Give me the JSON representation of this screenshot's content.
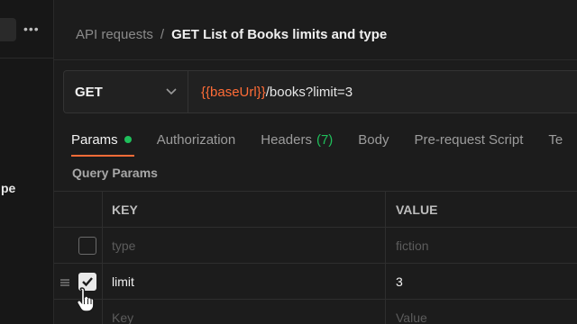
{
  "sidebar": {
    "more_icon": "more-horizontal-icon",
    "cut_item_text": "pe"
  },
  "breadcrumb": {
    "parent": "API requests",
    "separator": "/",
    "current": "GET List of Books limits and type"
  },
  "request": {
    "method": "GET",
    "url_variable": "{{baseUrl}}",
    "url_path": "/books?limit=3"
  },
  "tabs": [
    {
      "label": "Params",
      "active": true,
      "indicator": "green-dot"
    },
    {
      "label": "Authorization"
    },
    {
      "label": "Headers",
      "count": "(7)"
    },
    {
      "label": "Body"
    },
    {
      "label": "Pre-request Script"
    },
    {
      "label": "Te"
    }
  ],
  "query_params": {
    "title": "Query Params",
    "columns": [
      "KEY",
      "VALUE"
    ],
    "rows": [
      {
        "key": "type",
        "value": "fiction",
        "checked": false,
        "placeholder_style": true
      },
      {
        "key": "limit",
        "value": "3",
        "checked": true
      },
      {
        "key_placeholder": "Key",
        "value_placeholder": "Value"
      }
    ]
  },
  "colors": {
    "accent": "#ff6c37",
    "success": "#1fbf5b",
    "background": "#1c1c1c"
  }
}
